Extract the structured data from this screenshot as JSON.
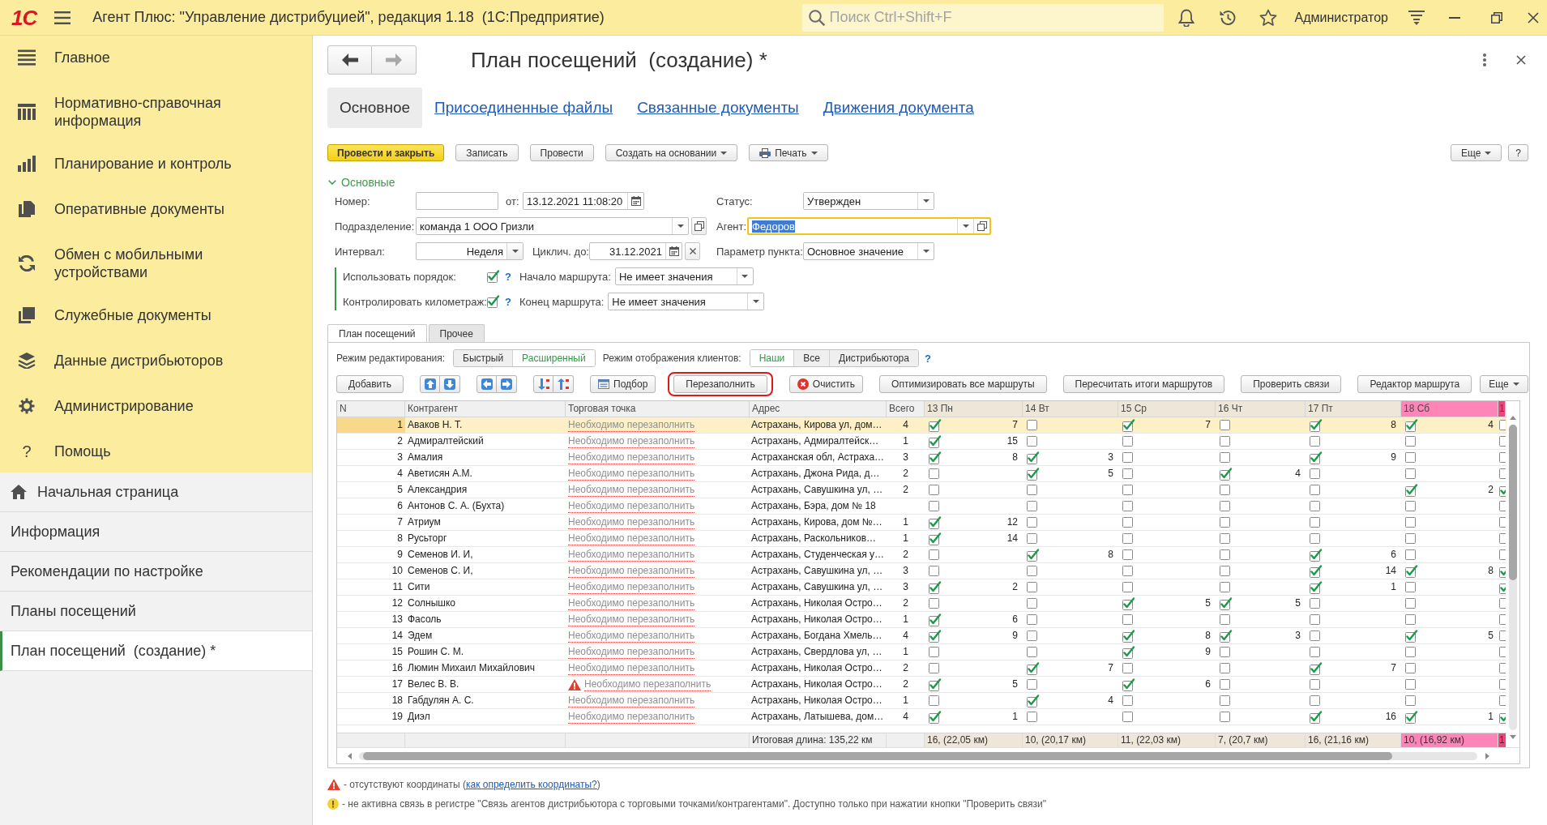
{
  "app_bar": {
    "logo": "1С",
    "title": "Агент Плюс: \"Управление дистрибуцией\", редакция 1.18  (1С:Предприятие)",
    "search": {
      "placeholder": "Поиск Ctrl+Shift+F"
    },
    "user": "Администратор"
  },
  "sidebar": {
    "sections": [
      {
        "kind": "main",
        "label": "Главное"
      },
      {
        "kind": "reference",
        "label": "Нормативно-справочная информация"
      },
      {
        "kind": "planning",
        "label": "Планирование и контроль"
      },
      {
        "kind": "documents",
        "label": "Оперативные документы"
      },
      {
        "kind": "exchange",
        "label": "Обмен с мобильными устройствами"
      },
      {
        "kind": "service",
        "label": "Служебные документы"
      },
      {
        "kind": "distributors",
        "label": "Данные дистрибьюторов"
      },
      {
        "kind": "admin",
        "label": "Администрирование"
      },
      {
        "kind": "help",
        "label": "Помощь",
        "glyph": "?"
      }
    ],
    "open_pages": [
      {
        "kind": "home",
        "label": "Начальная страница",
        "selected": false
      },
      {
        "kind": "page",
        "label": "Информация",
        "selected": false
      },
      {
        "kind": "page",
        "label": "Рекомендации по настройке",
        "selected": false
      },
      {
        "kind": "page",
        "label": "Планы посещений",
        "selected": false
      },
      {
        "kind": "page",
        "label": "План посещений  (создание) *",
        "selected": true
      }
    ]
  },
  "form": {
    "navigation": [
      {
        "kind": "back",
        "disabled": false
      },
      {
        "kind": "forward",
        "disabled": true
      }
    ],
    "title": "План посещений  (создание) *",
    "tabs": [
      {
        "label": "Основное",
        "selected": true
      },
      {
        "label": "Присоединенные файлы",
        "selected": false
      },
      {
        "label": "Связанные документы",
        "selected": false
      },
      {
        "label": "Движения документа",
        "selected": false
      }
    ],
    "commands": [
      {
        "kind": "default",
        "label": "Провести и закрыть"
      },
      {
        "kind": "plain",
        "label": "Записать"
      },
      {
        "kind": "plain",
        "label": "Провести"
      },
      {
        "kind": "menu",
        "label": "Создать на основании"
      },
      {
        "kind": "print",
        "label": "Печать"
      }
    ],
    "more": "Еще",
    "help": "?"
  },
  "group": {
    "title": "Основные",
    "expanded": true,
    "number": {
      "label": "Номер:"
    },
    "date": {
      "label": "от:",
      "value": "13.12.2021 11:08:20"
    },
    "status": {
      "label": "Статус:",
      "value": "Утвержден"
    },
    "division": {
      "label": "Подразделение:",
      "value": "команда 1 ООО Гризли"
    },
    "agent": {
      "label": "Агент:",
      "value": "Федоров",
      "focused": true
    },
    "interval": {
      "label": "Интервал:",
      "value": "Неделя"
    },
    "cycle_until": {
      "label": "Циклич. до:",
      "value": "31.12.2021"
    },
    "point_parameter": {
      "label": "Параметр пункта:",
      "value": "Основное значение"
    },
    "use_order": {
      "label": "Использовать порядок:",
      "checked": true,
      "help": "?"
    },
    "route_start": {
      "label": "Начало маршрута:",
      "value": "Не имеет значения"
    },
    "control_mileage": {
      "label": "Контролировать километраж:",
      "checked": true,
      "help": "?"
    },
    "route_end": {
      "label": "Конец маршрута:",
      "value": "Не имеет значения"
    }
  },
  "plan": {
    "tabs": [
      {
        "label": "План посещений",
        "selected": true
      },
      {
        "label": "Прочее",
        "selected": false
      }
    ],
    "edit_mode": {
      "label": "Режим редактирования:",
      "options": [
        {
          "label": "Быстрый",
          "selected": false
        },
        {
          "label": "Расширенный",
          "selected": true
        }
      ]
    },
    "client_mode": {
      "label": "Режим отображения клиентов:",
      "options": [
        {
          "label": "Наши",
          "selected": true
        },
        {
          "label": "Все",
          "selected": false
        },
        {
          "label": "Дистрибьютора",
          "selected": false
        }
      ]
    },
    "help": "?",
    "toolbar": [
      {
        "kind": "text",
        "label": "Добавить",
        "highlighted": false
      },
      {
        "kind": "move_vertical"
      },
      {
        "kind": "move_horizontal"
      },
      {
        "kind": "sort"
      },
      {
        "kind": "pick",
        "label": "Подбор",
        "highlighted": false
      },
      {
        "kind": "text",
        "label": "Перезаполнить",
        "highlighted": true
      },
      {
        "kind": "clear",
        "label": "Очистить",
        "highlighted": false
      },
      {
        "kind": "text",
        "label": "Оптимизировать все маршруты",
        "highlighted": false
      },
      {
        "kind": "text",
        "label": "Пересчитать итоги маршрутов",
        "highlighted": false
      },
      {
        "kind": "text",
        "label": "Проверить связи",
        "highlighted": false
      },
      {
        "kind": "text",
        "label": "Редактор маршрута",
        "highlighted": false
      }
    ],
    "more": "Еще",
    "table": {
      "columns": [
        "N",
        "Контрагент",
        "Торговая точка",
        "Адрес",
        "Всего"
      ],
      "days": [
        {
          "label": "13 Пн",
          "color": "#ede6d9",
          "total": "16, (22,05 км)"
        },
        {
          "label": "14 Вт",
          "color": "#ede6d9",
          "total": "10, (20,17 км)"
        },
        {
          "label": "15 Ср",
          "color": "#ede6d9",
          "total": "11, (22,03 км)"
        },
        {
          "label": "16 Чт",
          "color": "#ede6d9",
          "total": "7, (20,7 км)"
        },
        {
          "label": "17 Пт",
          "color": "#ede6d9",
          "total": "16, (21,16 км)"
        },
        {
          "label": "18 Сб",
          "color": "#ff85b8",
          "total": "10, (16,92 км)"
        },
        {
          "label": "1",
          "color": "#f0447f",
          "total": "1"
        }
      ],
      "rows": [
        {
          "n": "1",
          "client": "Аваков Н. Т.",
          "outlet": "Необходимо перезаполнить",
          "warning": false,
          "address": "Астрахань, Кирова ул, дом…",
          "total": "4",
          "selected": true,
          "days": [
            {
              "checked": true,
              "order": "7"
            },
            {
              "checked": false
            },
            {
              "checked": true,
              "order": "7"
            },
            {
              "checked": false
            },
            {
              "checked": true,
              "order": "8"
            },
            {
              "checked": true,
              "order": "4"
            },
            {
              "checked": false
            }
          ]
        },
        {
          "n": "2",
          "client": "Адмиралтейский",
          "outlet": "Необходимо перезаполнить",
          "warning": false,
          "address": "Астрахань, Адмиралтейск…",
          "total": "1",
          "selected": false,
          "days": [
            {
              "checked": true,
              "order": "15"
            },
            {
              "checked": false
            },
            {
              "checked": false
            },
            {
              "checked": false
            },
            {
              "checked": false
            },
            {
              "checked": false
            },
            {
              "checked": false
            }
          ]
        },
        {
          "n": "3",
          "client": "Амалия",
          "outlet": "Необходимо перезаполнить",
          "warning": false,
          "address": "Астраханская обл, Астраха…",
          "total": "3",
          "selected": false,
          "days": [
            {
              "checked": true,
              "order": "8"
            },
            {
              "checked": true,
              "order": "3"
            },
            {
              "checked": false
            },
            {
              "checked": false
            },
            {
              "checked": true,
              "order": "9"
            },
            {
              "checked": false
            },
            {
              "checked": false
            }
          ]
        },
        {
          "n": "4",
          "client": "Аветисян А.М.",
          "outlet": "Необходимо перезаполнить",
          "warning": false,
          "address": "Астрахань, Джона Рида, д…",
          "total": "2",
          "selected": false,
          "days": [
            {
              "checked": false
            },
            {
              "checked": true,
              "order": "5"
            },
            {
              "checked": false
            },
            {
              "checked": true,
              "order": "4"
            },
            {
              "checked": false
            },
            {
              "checked": false
            },
            {
              "checked": false
            }
          ]
        },
        {
          "n": "5",
          "client": "Александрия",
          "outlet": "Необходимо перезаполнить",
          "warning": false,
          "address": "Астрахань, Савушкина ул, …",
          "total": "2",
          "selected": false,
          "days": [
            {
              "checked": false
            },
            {
              "checked": false
            },
            {
              "checked": false
            },
            {
              "checked": false
            },
            {
              "checked": false
            },
            {
              "checked": true,
              "order": "2"
            },
            {
              "checked": true
            }
          ]
        },
        {
          "n": "6",
          "client": "Антонов С. А. (Бухта)",
          "outlet": "Необходимо перезаполнить",
          "warning": false,
          "address": "Астрахань, Бэра, дом № 18",
          "selected": false,
          "days": [
            {
              "checked": false
            },
            {
              "checked": false
            },
            {
              "checked": false
            },
            {
              "checked": false
            },
            {
              "checked": false
            },
            {
              "checked": false
            },
            {
              "checked": false
            }
          ]
        },
        {
          "n": "7",
          "client": "Атриум",
          "outlet": "Необходимо перезаполнить",
          "warning": false,
          "address": "Астрахань, Кирова, дом №…",
          "total": "1",
          "selected": false,
          "days": [
            {
              "checked": true,
              "order": "12"
            },
            {
              "checked": false
            },
            {
              "checked": false
            },
            {
              "checked": false
            },
            {
              "checked": false
            },
            {
              "checked": false
            },
            {
              "checked": false
            }
          ]
        },
        {
          "n": "8",
          "client": "Русьторг",
          "outlet": "Необходимо перезаполнить",
          "warning": false,
          "address": "Астрахань, Раскольников…",
          "total": "1",
          "selected": false,
          "days": [
            {
              "checked": true,
              "order": "14"
            },
            {
              "checked": false
            },
            {
              "checked": false
            },
            {
              "checked": false
            },
            {
              "checked": false
            },
            {
              "checked": false
            },
            {
              "checked": false
            }
          ]
        },
        {
          "n": "9",
          "client": "Семенов И. И,",
          "outlet": "Необходимо перезаполнить",
          "warning": false,
          "address": "Астрахань, Студенческая у…",
          "total": "2",
          "selected": false,
          "days": [
            {
              "checked": false
            },
            {
              "checked": true,
              "order": "8"
            },
            {
              "checked": false
            },
            {
              "checked": false
            },
            {
              "checked": true,
              "order": "6"
            },
            {
              "checked": false
            },
            {
              "checked": false
            }
          ]
        },
        {
          "n": "10",
          "client": "Семенов С. И,",
          "outlet": "Необходимо перезаполнить",
          "warning": false,
          "address": "Астрахань, Савушкина ул, …",
          "total": "3",
          "selected": false,
          "days": [
            {
              "checked": false
            },
            {
              "checked": false
            },
            {
              "checked": false
            },
            {
              "checked": false
            },
            {
              "checked": true,
              "order": "14"
            },
            {
              "checked": true,
              "order": "8"
            },
            {
              "checked": true
            }
          ]
        },
        {
          "n": "11",
          "client": "Сити",
          "outlet": "Необходимо перезаполнить",
          "warning": false,
          "address": "Астрахань, Савушкина ул, …",
          "total": "3",
          "selected": false,
          "days": [
            {
              "checked": true,
              "order": "2"
            },
            {
              "checked": false
            },
            {
              "checked": false
            },
            {
              "checked": false
            },
            {
              "checked": true,
              "order": "1"
            },
            {
              "checked": false
            },
            {
              "checked": true
            }
          ]
        },
        {
          "n": "12",
          "client": "Солнышко",
          "outlet": "Необходимо перезаполнить",
          "warning": false,
          "address": "Астрахань, Николая Остро…",
          "total": "2",
          "selected": false,
          "days": [
            {
              "checked": false
            },
            {
              "checked": false
            },
            {
              "checked": true,
              "order": "5"
            },
            {
              "checked": true,
              "order": "5"
            },
            {
              "checked": false
            },
            {
              "checked": false
            },
            {
              "checked": false
            }
          ]
        },
        {
          "n": "13",
          "client": "Фасоль",
          "outlet": "Необходимо перезаполнить",
          "warning": false,
          "address": "Астрахань, Николая Остро…",
          "total": "1",
          "selected": false,
          "days": [
            {
              "checked": true,
              "order": "6"
            },
            {
              "checked": false
            },
            {
              "checked": false
            },
            {
              "checked": false
            },
            {
              "checked": false
            },
            {
              "checked": false
            },
            {
              "checked": false
            }
          ]
        },
        {
          "n": "14",
          "client": "Эдем",
          "outlet": "Необходимо перезаполнить",
          "warning": false,
          "address": "Астрахань, Богдана Хмель…",
          "total": "4",
          "selected": false,
          "days": [
            {
              "checked": true,
              "order": "9"
            },
            {
              "checked": false
            },
            {
              "checked": true,
              "order": "8"
            },
            {
              "checked": true,
              "order": "3"
            },
            {
              "checked": false
            },
            {
              "checked": true,
              "order": "5"
            },
            {
              "checked": false
            }
          ]
        },
        {
          "n": "15",
          "client": "Рошин С. М.",
          "outlet": "Необходимо перезаполнить",
          "warning": false,
          "address": "Астрахань, Свердлова ул, …",
          "total": "1",
          "selected": false,
          "days": [
            {
              "checked": false
            },
            {
              "checked": false
            },
            {
              "checked": true,
              "order": "9"
            },
            {
              "checked": false
            },
            {
              "checked": false
            },
            {
              "checked": false
            },
            {
              "checked": false
            }
          ]
        },
        {
          "n": "16",
          "client": "Люмин Михаил Михайлович",
          "outlet": "Необходимо перезаполнить",
          "warning": false,
          "address": "Астрахань, Николая Остро…",
          "total": "2",
          "selected": false,
          "days": [
            {
              "checked": false
            },
            {
              "checked": true,
              "order": "7"
            },
            {
              "checked": false
            },
            {
              "checked": false
            },
            {
              "checked": true,
              "order": "7"
            },
            {
              "checked": false
            },
            {
              "checked": false
            }
          ]
        },
        {
          "n": "17",
          "client": "Велес В. В.",
          "outlet": "Необходимо перезаполнить",
          "warning": true,
          "address": "Астрахань, Николая Остро…",
          "total": "2",
          "selected": false,
          "days": [
            {
              "checked": true,
              "order": "5"
            },
            {
              "checked": false
            },
            {
              "checked": true,
              "order": "6"
            },
            {
              "checked": false
            },
            {
              "checked": false
            },
            {
              "checked": false
            },
            {
              "checked": false
            }
          ]
        },
        {
          "n": "18",
          "client": "Габдулян А. С.",
          "outlet": "Необходимо перезаполнить",
          "warning": false,
          "address": "Астрахань, Николая Остро…",
          "total": "1",
          "selected": false,
          "days": [
            {
              "checked": false
            },
            {
              "checked": true,
              "order": "4"
            },
            {
              "checked": false
            },
            {
              "checked": false
            },
            {
              "checked": false
            },
            {
              "checked": false
            },
            {
              "checked": false
            }
          ]
        },
        {
          "n": "19",
          "client": "Диэл",
          "outlet": "Необходимо перезаполнить",
          "warning": false,
          "address": "Астрахань, Латышева, дом…",
          "total": "4",
          "selected": false,
          "days": [
            {
              "checked": true,
              "order": "1"
            },
            {
              "checked": false
            },
            {
              "checked": false
            },
            {
              "checked": false
            },
            {
              "checked": true,
              "order": "16"
            },
            {
              "checked": true,
              "order": "1"
            },
            {
              "checked": true
            }
          ]
        }
      ],
      "footer": "Итоговая длина: 135,22 км"
    }
  },
  "legend": [
    {
      "kind": "warning",
      "text": "- отсутствуют координаты (",
      "link": "как определить координаты?",
      "text_after": ")"
    },
    {
      "kind": "info",
      "text": "- не активна связь в регистре \"Связь агентов дистрибьютора с торговыми точками/контрагентами\". Доступно только при нажатии кнопки \"Проверить связи\""
    }
  ]
}
